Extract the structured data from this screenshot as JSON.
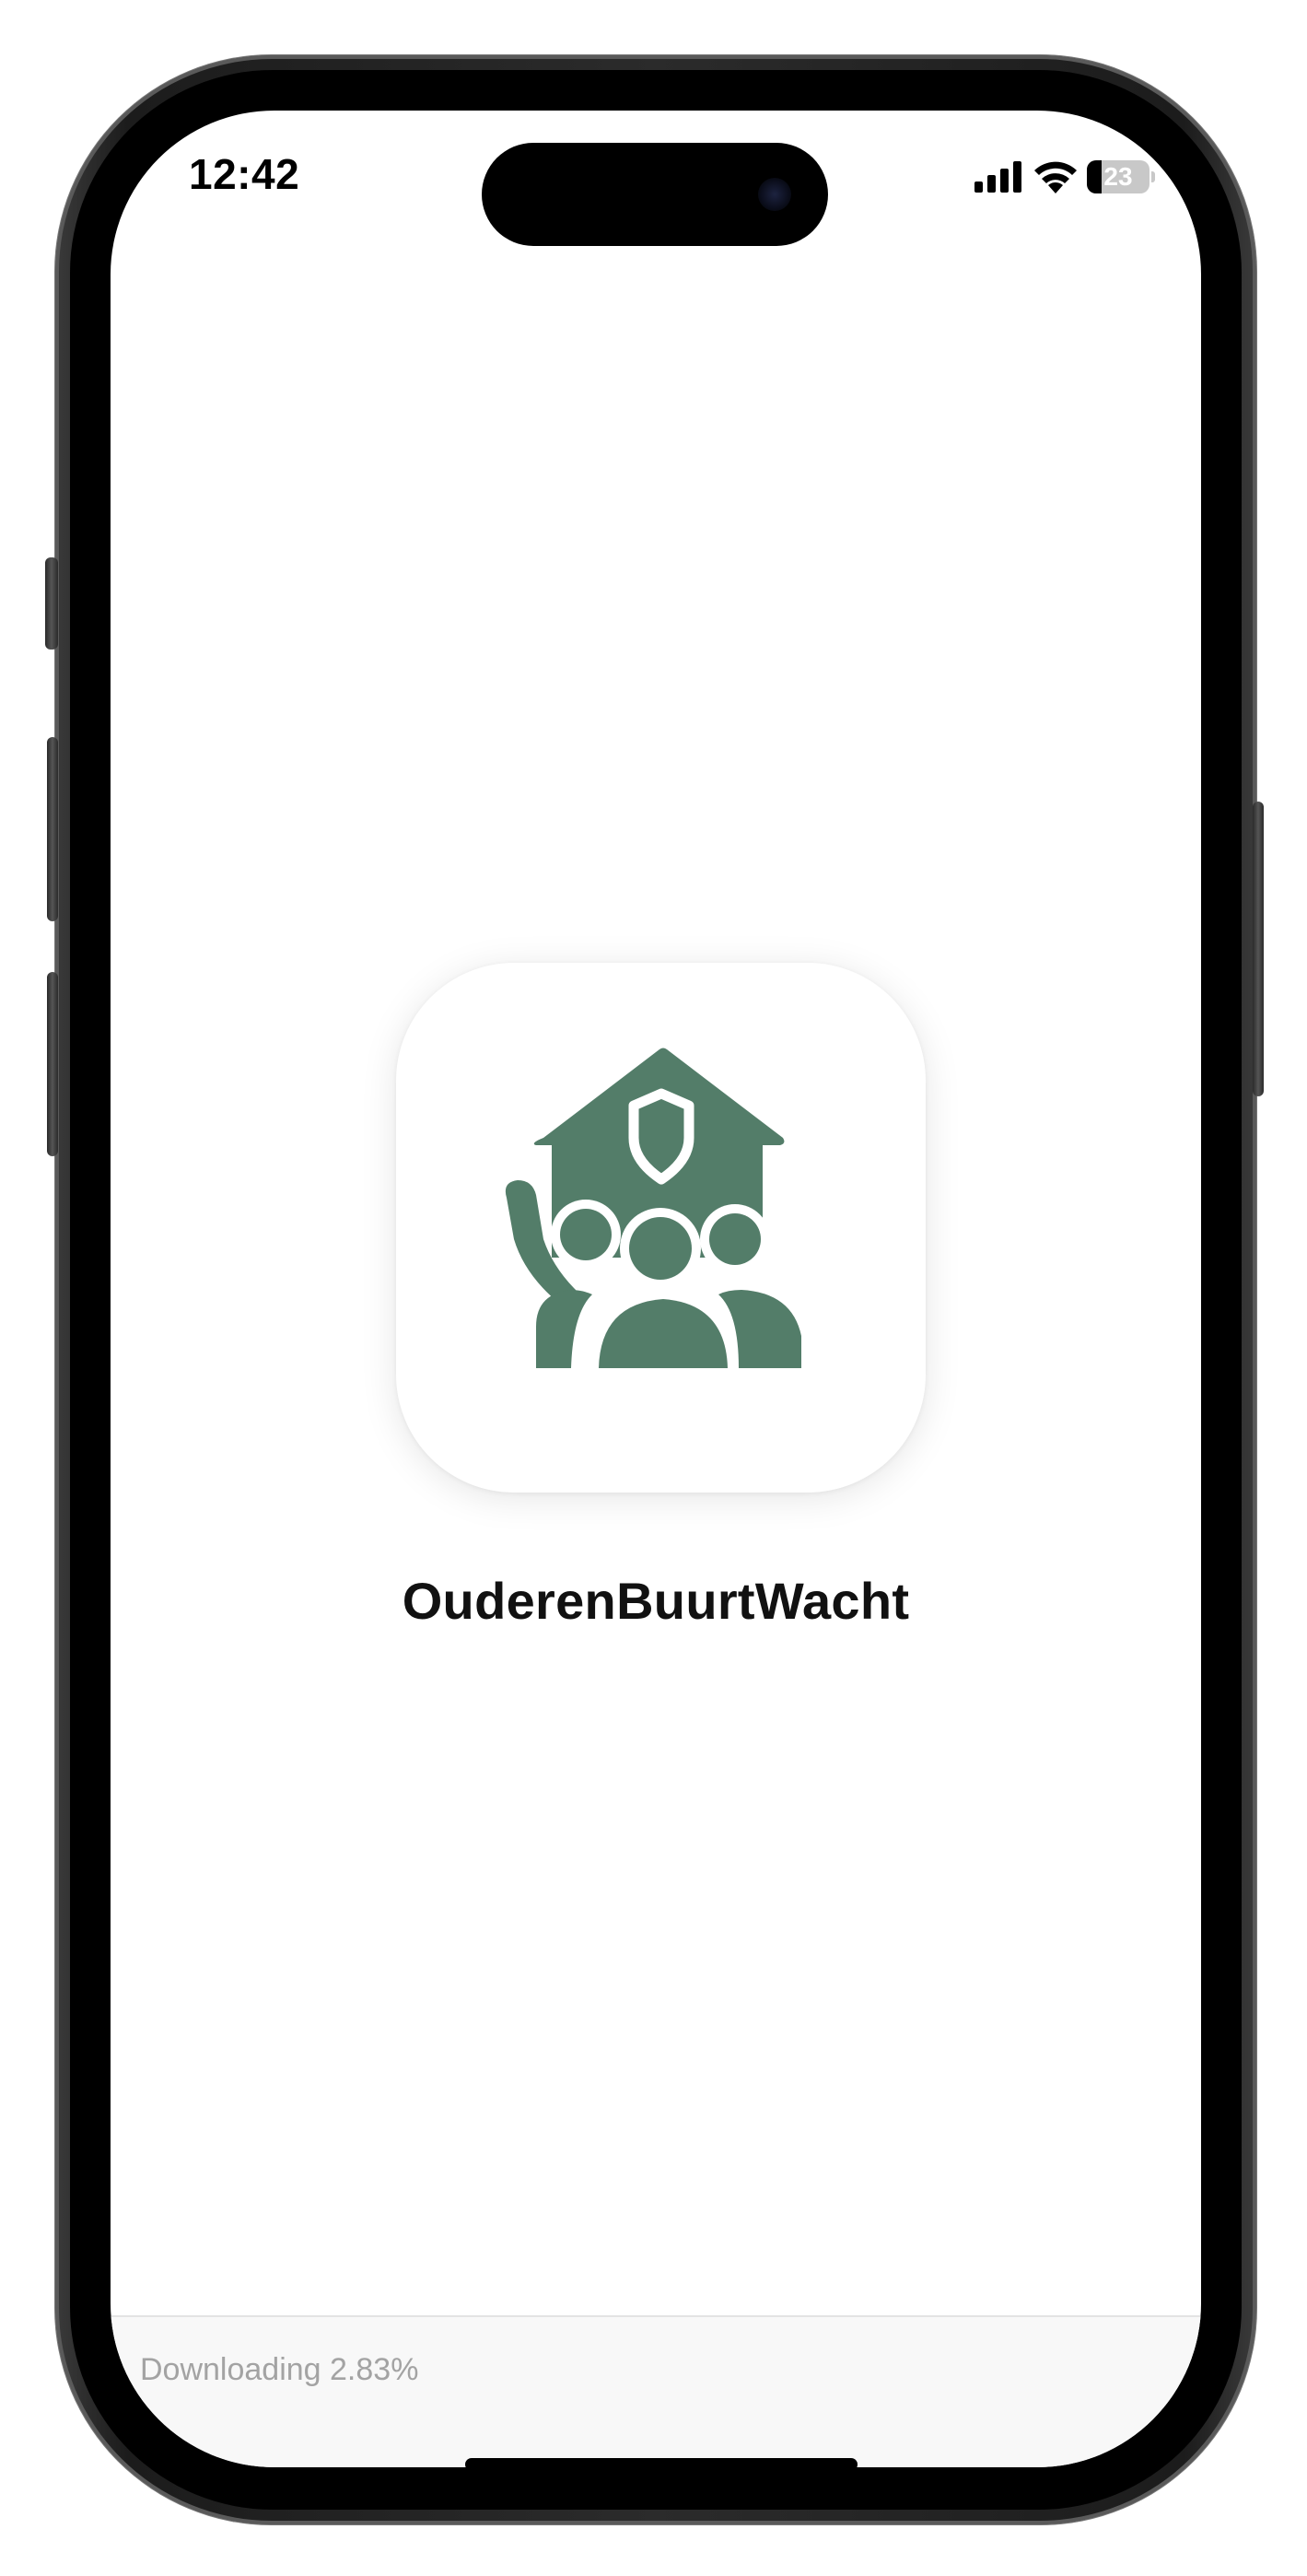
{
  "status_bar": {
    "time": "12:42",
    "battery_level": "23",
    "battery_fraction": 0.23
  },
  "app": {
    "name": "OuderenBuurtWacht",
    "icon": "house-shield-people-icon",
    "icon_color": "#537d69"
  },
  "download": {
    "status_text": "Downloading 2.83%",
    "progress_percent": 2.83
  }
}
